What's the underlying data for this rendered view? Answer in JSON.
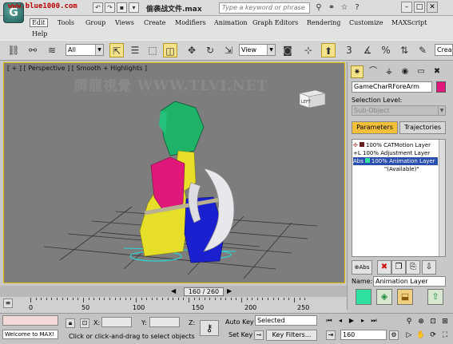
{
  "titlebar": {
    "watermark": "www.blue1000.com",
    "file_title": "偷袭战文件.max",
    "search_placeholder": "Type a keyword or phrase"
  },
  "menu": [
    "Edit",
    "Tools",
    "Group",
    "Views",
    "Create",
    "Modifiers",
    "Animation",
    "Graph Editors",
    "Rendering",
    "Customize",
    "MAXScript",
    "Help"
  ],
  "toolbar": {
    "filter_value": "All",
    "view_value": "View",
    "search_stub": "Crea"
  },
  "viewport": {
    "label": "[ + ] [ Perspective ] [ Smooth + Highlights ]",
    "watermark": "腾龍視覺 WWW.TLVI.NET",
    "viewcube_label": "LEFT"
  },
  "command_panel": {
    "object_name": "GameCharRForeArm",
    "selection_level_label": "Selection Level:",
    "sub_object": "Sub-Object",
    "tabs": [
      "Parameters",
      "Trajectories"
    ],
    "layers": [
      {
        "prefix": "",
        "text": "100% CATMotion Layer"
      },
      {
        "prefix": "+L",
        "text": "100% Adjustment Layer"
      },
      {
        "prefix": "Abs",
        "text": "100% Animation Layer"
      },
      {
        "prefix": "",
        "text": "\"(Available)\""
      }
    ],
    "name_label": "Name:",
    "layer_name": "Animation Layer",
    "abs_button": "Abs"
  },
  "timeline": {
    "current": "160 / 260",
    "ticks": [
      "0",
      "50",
      "100",
      "150",
      "200",
      "250"
    ]
  },
  "status": {
    "welcome": "Welcome to MAX!",
    "x_label": "X:",
    "y_label": "Y:",
    "z_label": "Z:",
    "prompt": "Click or click-and-drag to select objects",
    "auto_key": "Auto Key",
    "set_key": "Set Key",
    "selected": "Selected",
    "key_filters": "Key Filters...",
    "frame": "160"
  }
}
